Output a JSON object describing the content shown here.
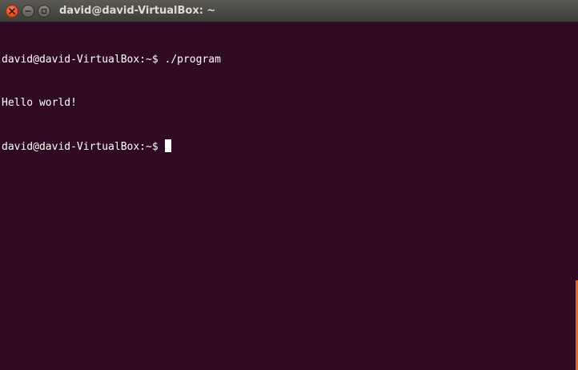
{
  "window": {
    "title": "david@david-VirtualBox: ~",
    "controls": {
      "close_icon": "close-icon",
      "minimize_icon": "minimize-icon",
      "maximize_icon": "maximize-icon"
    }
  },
  "terminal": {
    "lines": [
      {
        "prompt": "david@david-VirtualBox:~$",
        "command": "./program"
      },
      {
        "output": "Hello world!"
      },
      {
        "prompt": "david@david-VirtualBox:~$",
        "command": ""
      }
    ],
    "colors": {
      "background": "#300a24",
      "text": "#ffffff",
      "scrollbar_thumb": "#e06a2c"
    }
  }
}
